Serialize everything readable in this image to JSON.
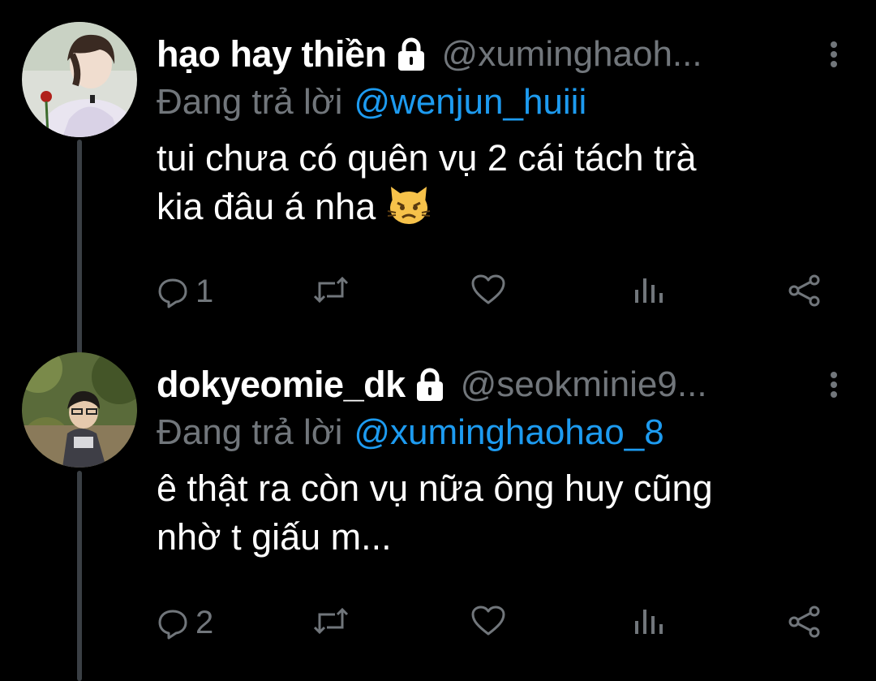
{
  "colors": {
    "background": "#000000",
    "primary_text": "#ffffff",
    "secondary_text": "#71767b",
    "mention": "#1d9bf0",
    "thread_line": "#3a3f44"
  },
  "tweets": [
    {
      "display_name": "hạo hay thiền",
      "handle": "@xuminghaoh...",
      "reply_prefix": "Đang trả lời",
      "reply_to": "@wenjun_huiii",
      "text_line1": "tui chưa có quên vụ 2 cái tách trà",
      "text_line2": "kia đâu á nha",
      "emoji": "pouting-cat-emoji",
      "reply_count": "1",
      "icons": [
        "lock-icon",
        "more-icon",
        "reply-icon",
        "retweet-icon",
        "like-icon",
        "analytics-icon",
        "share-icon"
      ]
    },
    {
      "display_name": "dokyeomie_dk",
      "handle": "@seokminie9...",
      "reply_prefix": "Đang trả lời",
      "reply_to": "@xuminghaohao_8",
      "text_line1": "ê thật ra còn vụ nữa ông huy cũng",
      "text_line2": "nhờ t giấu m...",
      "reply_count": "2",
      "icons": [
        "lock-icon",
        "more-icon",
        "reply-icon",
        "retweet-icon",
        "like-icon",
        "analytics-icon",
        "share-icon"
      ]
    }
  ]
}
